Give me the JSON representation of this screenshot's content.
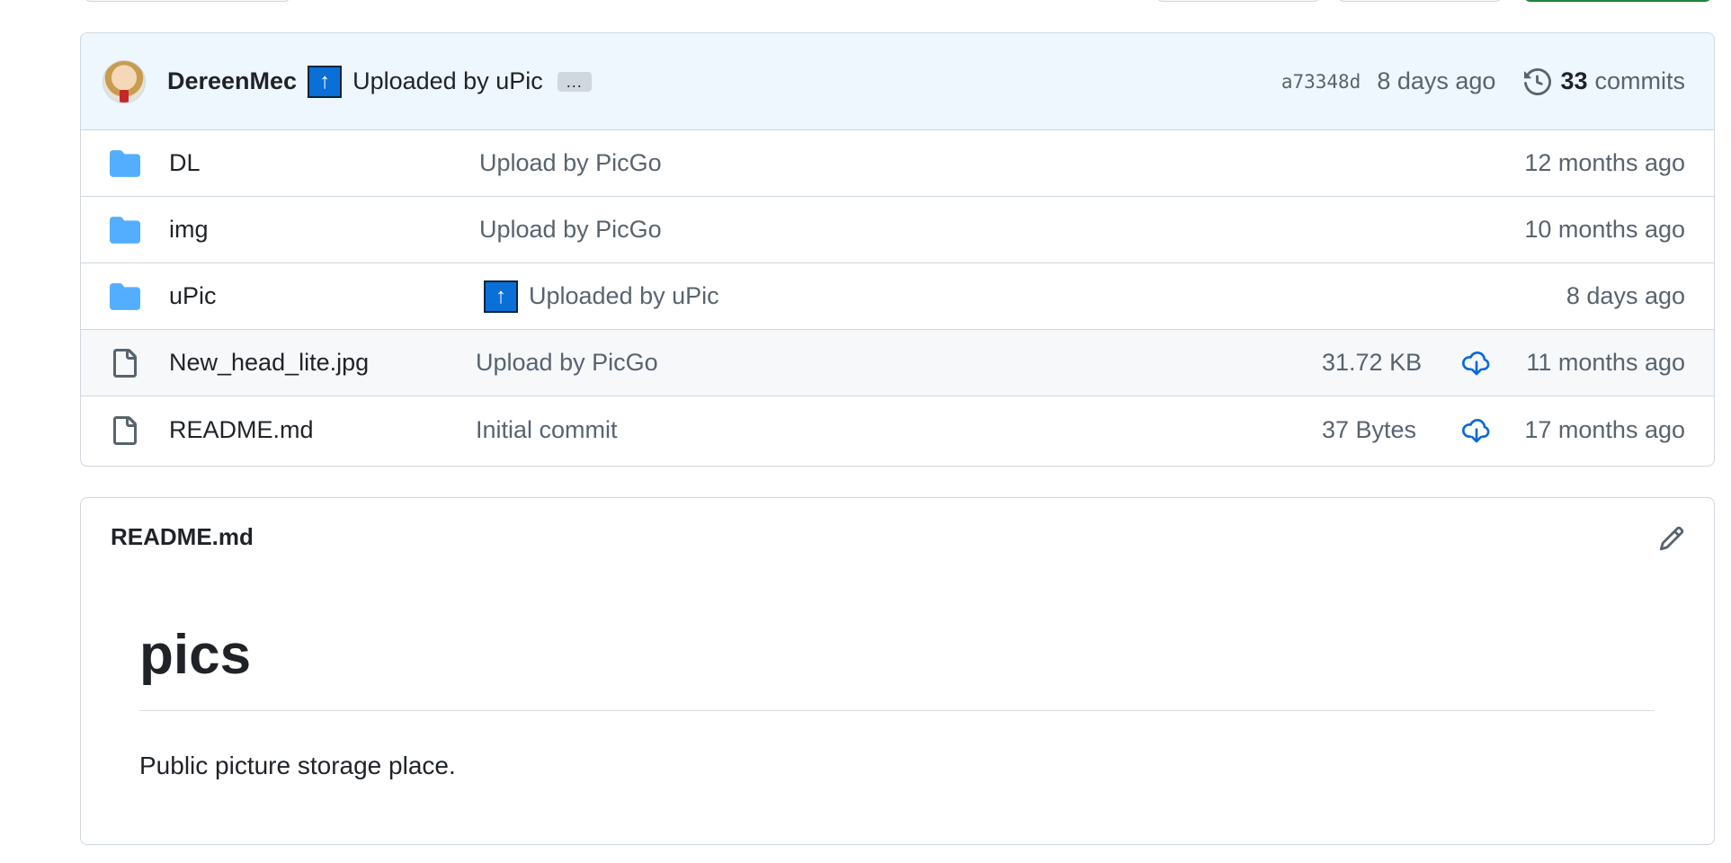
{
  "commit": {
    "author": "DereenMec",
    "badge_icon": "upload-arrow",
    "message": "Uploaded by uPic",
    "ellipsis": "...",
    "sha": "a73348d",
    "time": "8 days ago",
    "commit_count": "33",
    "commit_label": "commits"
  },
  "files": [
    {
      "type": "folder",
      "name": "DL",
      "message": "Upload by PicGo",
      "size": "",
      "time": "12 months ago",
      "has_badge": false
    },
    {
      "type": "folder",
      "name": "img",
      "message": "Upload by PicGo",
      "size": "",
      "time": "10 months ago",
      "has_badge": false
    },
    {
      "type": "folder",
      "name": "uPic",
      "message": "Uploaded by uPic",
      "size": "",
      "time": "8 days ago",
      "has_badge": true
    },
    {
      "type": "file",
      "name": "New_head_lite.jpg",
      "message": "Upload by PicGo",
      "size": "31.72 KB",
      "time": "11 months ago",
      "has_badge": false
    },
    {
      "type": "file",
      "name": "README.md",
      "message": "Initial commit",
      "size": "37 Bytes",
      "time": "17 months ago",
      "has_badge": false
    }
  ],
  "readme": {
    "filename": "README.md",
    "title": "pics",
    "body": "Public picture storage place."
  },
  "colors": {
    "folder": "#54aeff",
    "accent": "#0969da",
    "commit_bar_bg": "#eef6fe",
    "badge_bg": "#0a6fd6"
  }
}
